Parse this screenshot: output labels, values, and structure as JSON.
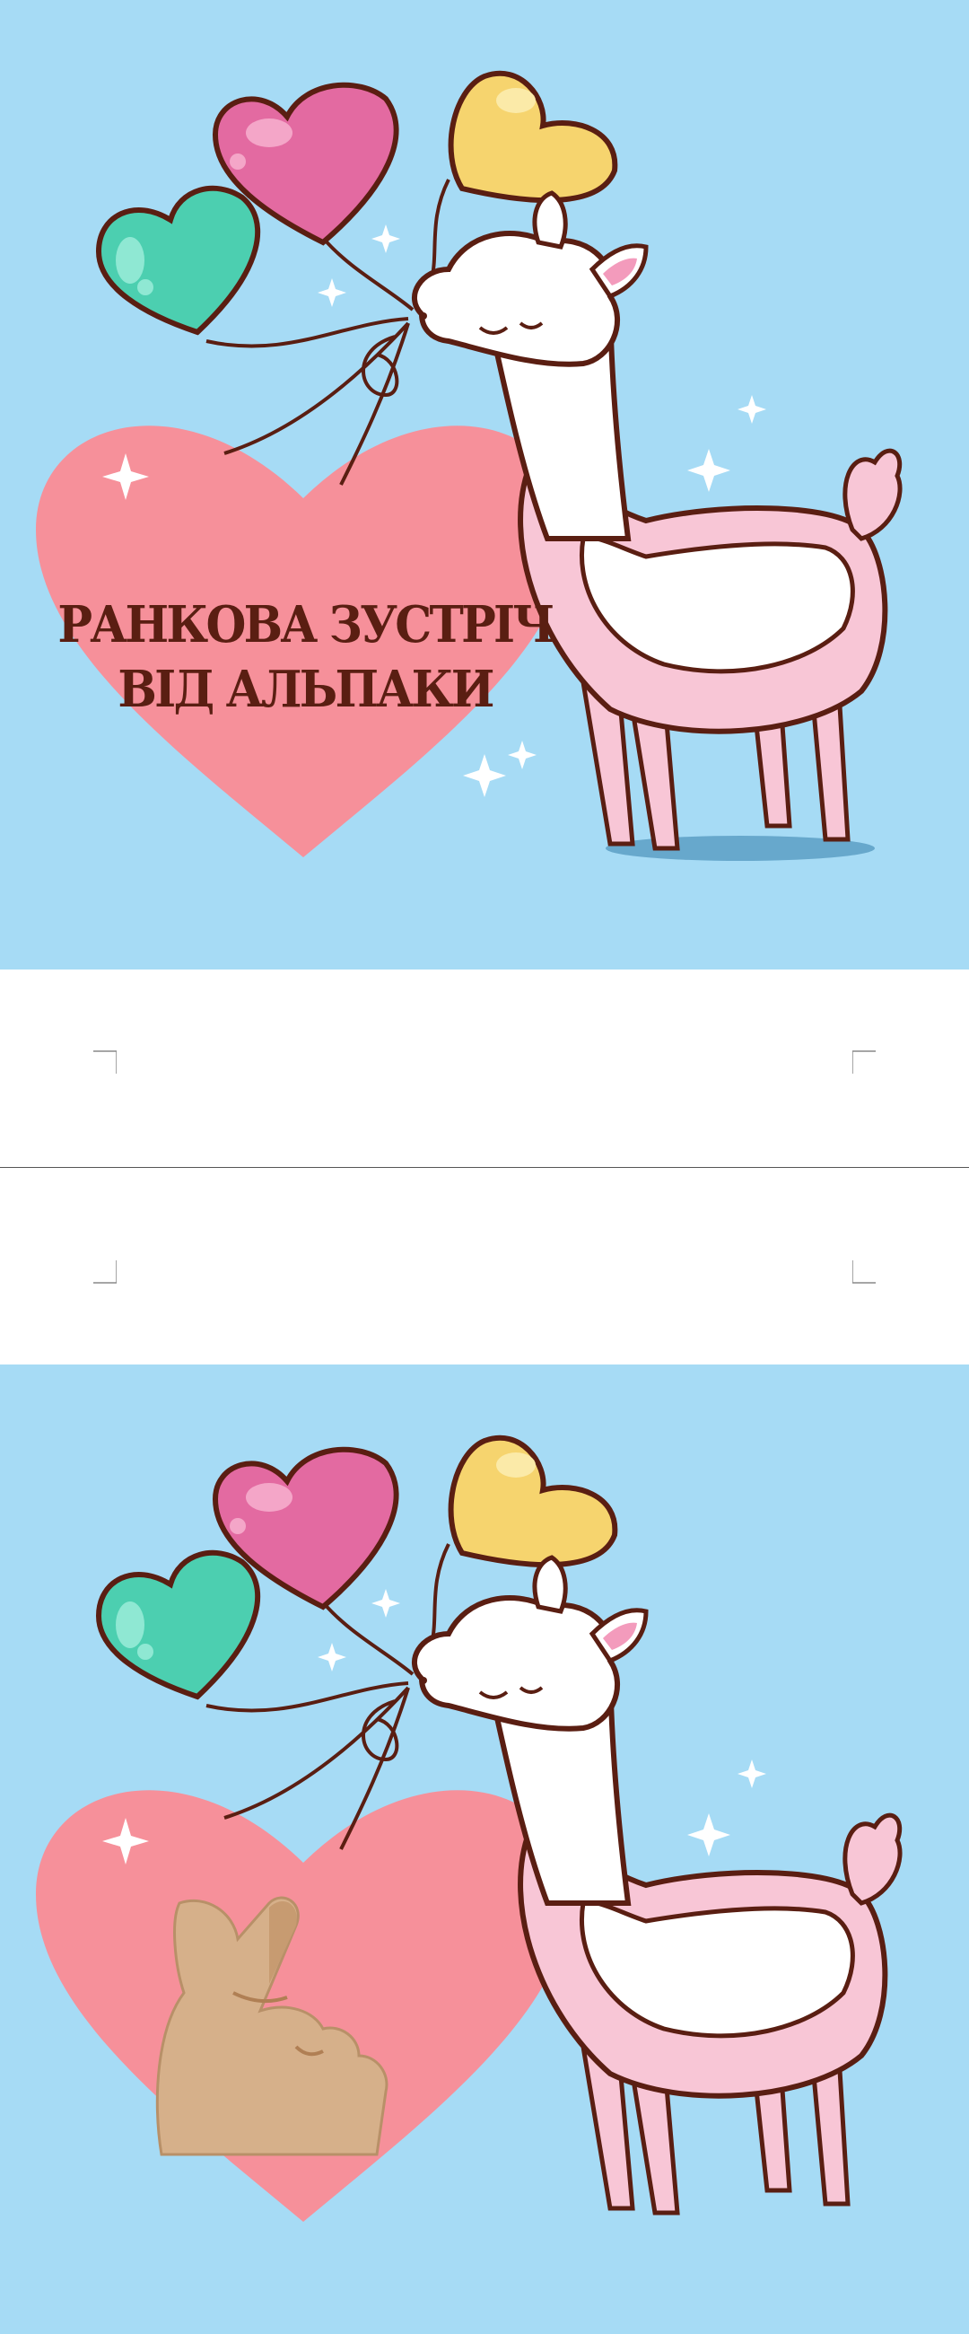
{
  "card1": {
    "title_line1": "РАНКОВА ЗУСТРІЧ",
    "title_line2": "ВІД АЛЬПАКИ"
  },
  "icons": [
    "heart-balloon-icon",
    "alpaca-illustration",
    "sparkle-icon",
    "finger-heart-icon"
  ],
  "colors": {
    "background": "#a6dbf5",
    "heart": "#f6909a",
    "title_text": "#5a1e12",
    "balloon_pink": "#e36aa1",
    "balloon_yellow": "#f6d46e",
    "balloon_teal": "#4ccfb0"
  }
}
